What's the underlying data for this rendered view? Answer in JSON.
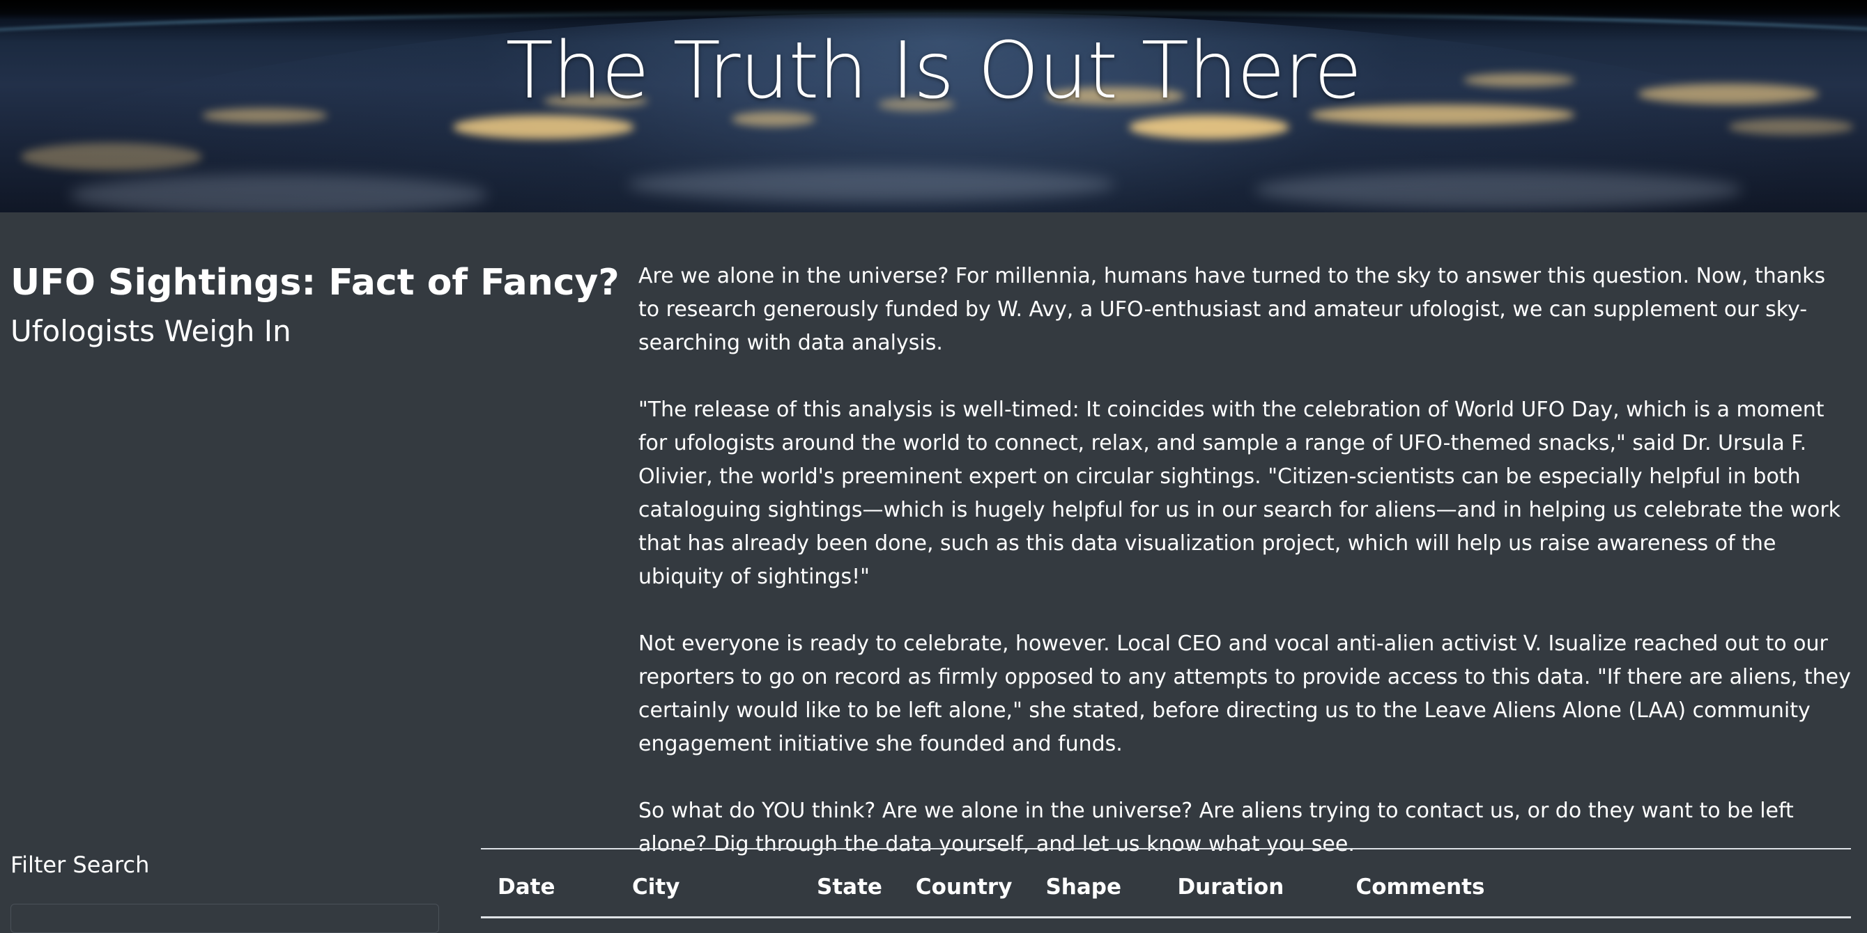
{
  "hero": {
    "title": "The Truth Is Out There"
  },
  "intro": {
    "title": "UFO Sightings: Fact of Fancy?",
    "subtitle": "Ufologists Weigh In"
  },
  "article": {
    "paragraphs": [
      "Are we alone in the universe? For millennia, humans have turned to the sky to answer this question. Now, thanks to research generously funded by W. Avy, a UFO-enthusiast and amateur ufologist, we can supplement our sky-searching with data analysis.",
      "\"The release of this analysis is well-timed: It coincides with the celebration of World UFO Day, which is a moment for ufologists around the world to connect, relax, and sample a range of UFO-themed snacks,\" said Dr. Ursula F. Olivier, the world's preeminent expert on circular sightings. \"Citizen-scientists can be especially helpful in both cataloguing sightings—which is hugely helpful for us in our search for aliens—and in helping us celebrate the work that has already been done, such as this data visualization project, which will help us raise awareness of the ubiquity of sightings!\"",
      "Not everyone is ready to celebrate, however. Local CEO and vocal anti-alien activist V. Isualize reached out to our reporters to go on record as firmly opposed to any attempts to provide access to this data. \"If there are aliens, they certainly would like to be left alone,\" she stated, before directing us to the Leave Aliens Alone (LAA) community engagement initiative she founded and funds.",
      "So what do YOU think? Are we alone in the universe? Are aliens trying to contact us, or do they want to be left alone? Dig through the data yourself, and let us know what you see."
    ]
  },
  "filter": {
    "label": "Filter Search"
  },
  "table": {
    "headers": [
      "Date",
      "City",
      "State",
      "Country",
      "Shape",
      "Duration",
      "Comments"
    ]
  }
}
